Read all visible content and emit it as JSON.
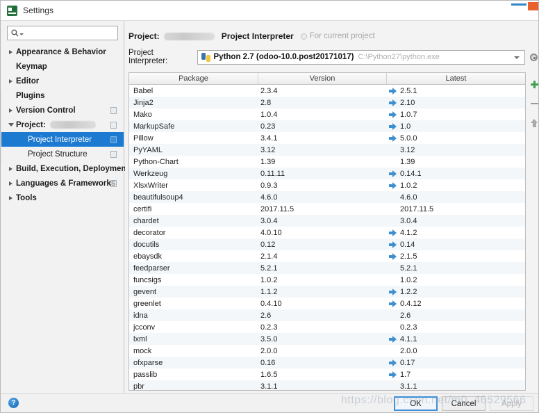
{
  "window": {
    "title": "Settings",
    "icon": "pycharm-icon"
  },
  "sidebar": {
    "search": {
      "placeholder": "",
      "value": "",
      "icon": "search-icon"
    },
    "items": [
      {
        "label": "Appearance & Behavior",
        "chevron": "collapsed",
        "level": 0,
        "badge": false,
        "selected": false
      },
      {
        "label": "Keymap",
        "chevron": "none",
        "level": 0,
        "badge": false,
        "selected": false
      },
      {
        "label": "Editor",
        "chevron": "collapsed",
        "level": 0,
        "badge": false,
        "selected": false
      },
      {
        "label": "Plugins",
        "chevron": "none",
        "level": 0,
        "badge": false,
        "selected": false
      },
      {
        "label": "Version Control",
        "chevron": "collapsed",
        "level": 0,
        "badge": true,
        "selected": false
      },
      {
        "label": "Project:",
        "chevron": "expanded",
        "level": 0,
        "badge": true,
        "selected": false,
        "redacted": true
      },
      {
        "label": "Project Interpreter",
        "chevron": "none",
        "level": 1,
        "badge": true,
        "selected": true
      },
      {
        "label": "Project Structure",
        "chevron": "none",
        "level": 1,
        "badge": true,
        "selected": false
      },
      {
        "label": "Build, Execution, Deployment",
        "chevron": "collapsed",
        "level": 0,
        "badge": false,
        "selected": false
      },
      {
        "label": "Languages & Frameworks",
        "chevron": "collapsed",
        "level": 0,
        "badge": true,
        "selected": false
      },
      {
        "label": "Tools",
        "chevron": "collapsed",
        "level": 0,
        "badge": false,
        "selected": false
      }
    ]
  },
  "main": {
    "breadcrumb": {
      "project_label": "Project:",
      "project_name_redacted": true,
      "page_title": "Project Interpreter",
      "scope_note": "For current project"
    },
    "interpreter": {
      "label": "Project Interpreter:",
      "value": "Python 2.7 (odoo-10.0.post20171017)",
      "path": "C:\\Python27\\python.exe",
      "icon": "python-icon",
      "dropdown_icon": "chevron-down-icon",
      "settings_icon": "gear-icon"
    },
    "tools": [
      {
        "name": "install-package-button",
        "icon": "plus-icon",
        "color": "#3f9d4f"
      },
      {
        "name": "uninstall-package-button",
        "icon": "minus-icon",
        "color": "#9a9a9a"
      },
      {
        "name": "upgrade-package-button",
        "icon": "arrow-up-icon",
        "color": "#a9a9a9"
      }
    ],
    "table": {
      "columns": [
        "Package",
        "Version",
        "Latest"
      ],
      "rows": [
        {
          "package": "Babel",
          "version": "2.3.4",
          "latest": "2.5.1",
          "upgrade": true
        },
        {
          "package": "Jinja2",
          "version": "2.8",
          "latest": "2.10",
          "upgrade": true
        },
        {
          "package": "Mako",
          "version": "1.0.4",
          "latest": "1.0.7",
          "upgrade": true
        },
        {
          "package": "MarkupSafe",
          "version": "0.23",
          "latest": "1.0",
          "upgrade": true
        },
        {
          "package": "Pillow",
          "version": "3.4.1",
          "latest": "5.0.0",
          "upgrade": true
        },
        {
          "package": "PyYAML",
          "version": "3.12",
          "latest": "3.12",
          "upgrade": false
        },
        {
          "package": "Python-Chart",
          "version": "1.39",
          "latest": "1.39",
          "upgrade": false
        },
        {
          "package": "Werkzeug",
          "version": "0.11.11",
          "latest": "0.14.1",
          "upgrade": true
        },
        {
          "package": "XlsxWriter",
          "version": "0.9.3",
          "latest": "1.0.2",
          "upgrade": true
        },
        {
          "package": "beautifulsoup4",
          "version": "4.6.0",
          "latest": "4.6.0",
          "upgrade": false
        },
        {
          "package": "certifi",
          "version": "2017.11.5",
          "latest": "2017.11.5",
          "upgrade": false
        },
        {
          "package": "chardet",
          "version": "3.0.4",
          "latest": "3.0.4",
          "upgrade": false
        },
        {
          "package": "decorator",
          "version": "4.0.10",
          "latest": "4.1.2",
          "upgrade": true
        },
        {
          "package": "docutils",
          "version": "0.12",
          "latest": "0.14",
          "upgrade": true
        },
        {
          "package": "ebaysdk",
          "version": "2.1.4",
          "latest": "2.1.5",
          "upgrade": true
        },
        {
          "package": "feedparser",
          "version": "5.2.1",
          "latest": "5.2.1",
          "upgrade": false
        },
        {
          "package": "funcsigs",
          "version": "1.0.2",
          "latest": "1.0.2",
          "upgrade": false
        },
        {
          "package": "gevent",
          "version": "1.1.2",
          "latest": "1.2.2",
          "upgrade": true
        },
        {
          "package": "greenlet",
          "version": "0.4.10",
          "latest": "0.4.12",
          "upgrade": true
        },
        {
          "package": "idna",
          "version": "2.6",
          "latest": "2.6",
          "upgrade": false
        },
        {
          "package": "jcconv",
          "version": "0.2.3",
          "latest": "0.2.3",
          "upgrade": false
        },
        {
          "package": "lxml",
          "version": "3.5.0",
          "latest": "4.1.1",
          "upgrade": true
        },
        {
          "package": "mock",
          "version": "2.0.0",
          "latest": "2.0.0",
          "upgrade": false
        },
        {
          "package": "ofxparse",
          "version": "0.16",
          "latest": "0.17",
          "upgrade": true
        },
        {
          "package": "passlib",
          "version": "1.6.5",
          "latest": "1.7",
          "upgrade": true
        },
        {
          "package": "pbr",
          "version": "3.1.1",
          "latest": "3.1.1",
          "upgrade": false
        }
      ]
    }
  },
  "footer": {
    "help_icon": "?",
    "ok_label": "OK",
    "cancel_label": "Cancel",
    "apply_label": "Apply"
  },
  "watermark": {
    "text": "https://blog.csdn.net/m0_46529566"
  },
  "colors": {
    "selection": "#1c7ad1",
    "upgrade_arrow": "#3e8fd0",
    "install_green": "#3f9d4f",
    "accent_button": "#3b8fd6"
  }
}
